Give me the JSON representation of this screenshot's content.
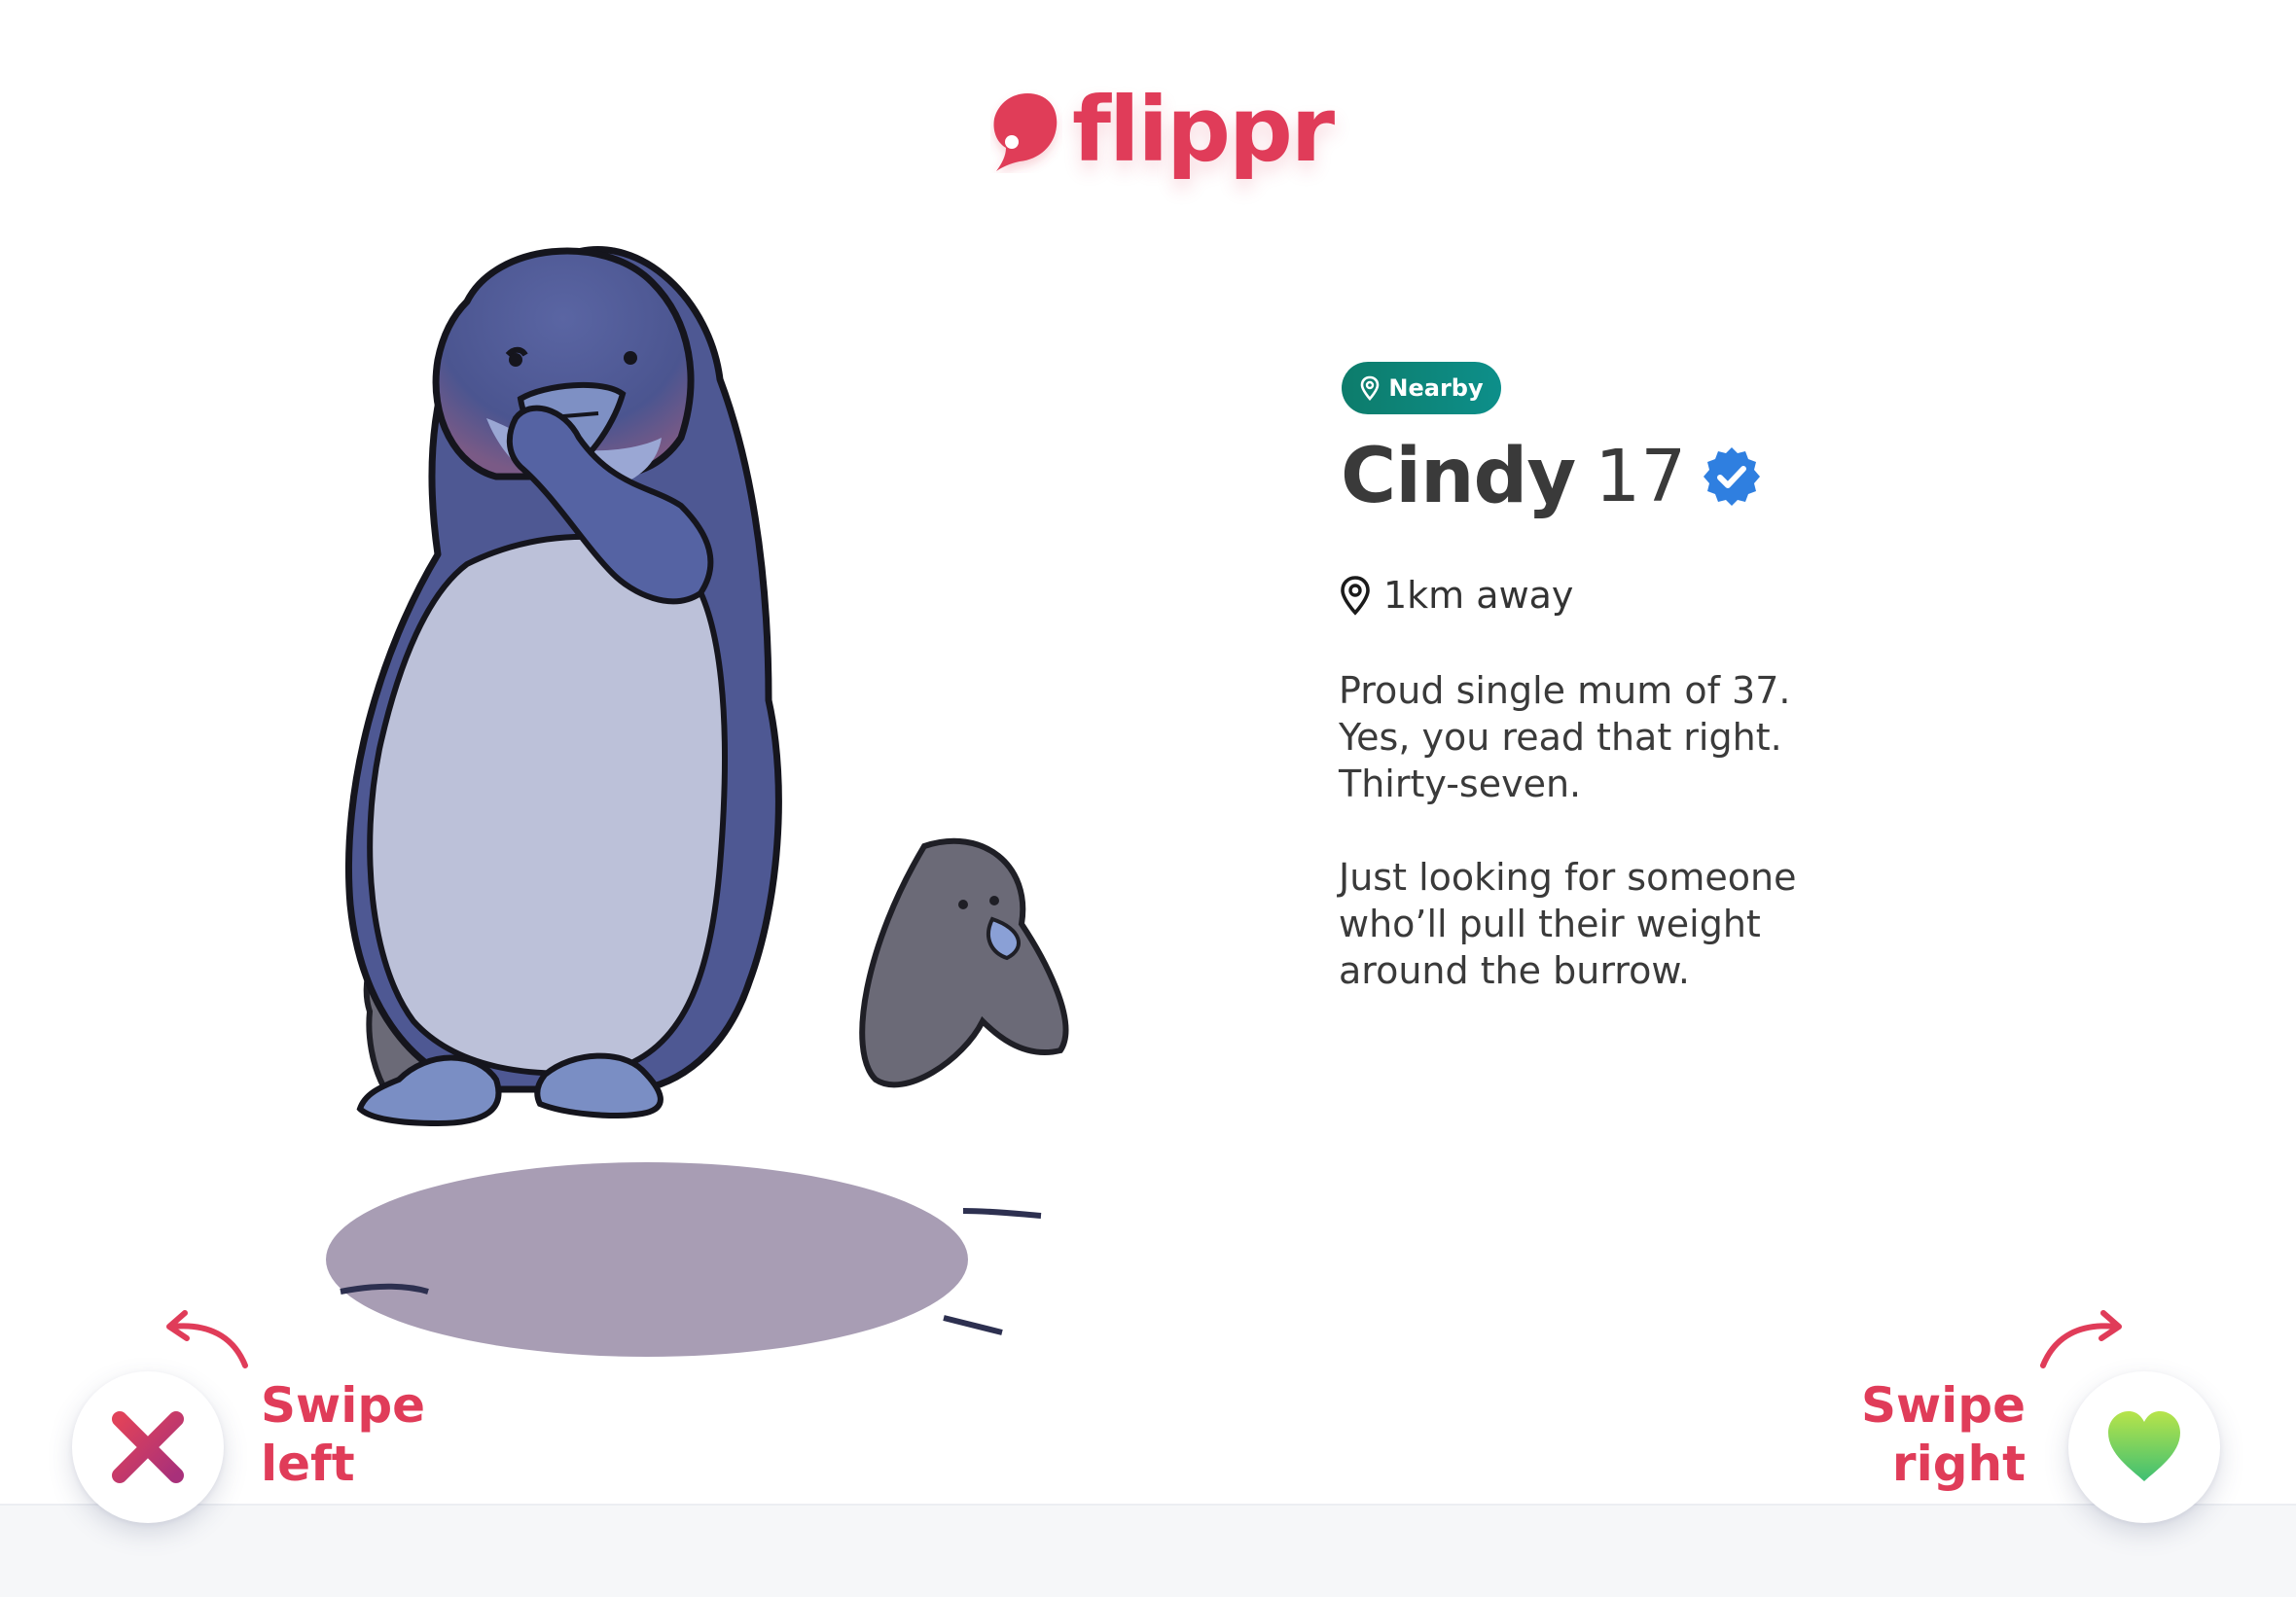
{
  "app": {
    "name": "flippr",
    "brand_color": "#e03c59"
  },
  "profile": {
    "badge": "Nearby",
    "name": "Cindy",
    "age": "17",
    "verified_icon": "verified-badge-icon",
    "distance": "1km away",
    "bio": [
      [
        "Proud single mum of 37.",
        "Yes, you read that right.",
        "Thirty-seven."
      ],
      [
        "Just looking for someone",
        "who’ll pull their weight",
        "around the burrow."
      ]
    ],
    "photo": "penguin-illustration"
  },
  "actions": {
    "left": {
      "line1": "Swipe",
      "line2": "left",
      "icon": "close-x-icon"
    },
    "right": {
      "line1": "Swipe",
      "line2": "right",
      "icon": "heart-icon"
    }
  },
  "colors": {
    "nearby_badge": "#0d8f8a",
    "verified": "#2f7fe0",
    "heart_gradient_start": "#b7e44a",
    "heart_gradient_end": "#3fbf73",
    "x_gradient_start": "#e0425a",
    "x_gradient_end": "#a8307a"
  }
}
